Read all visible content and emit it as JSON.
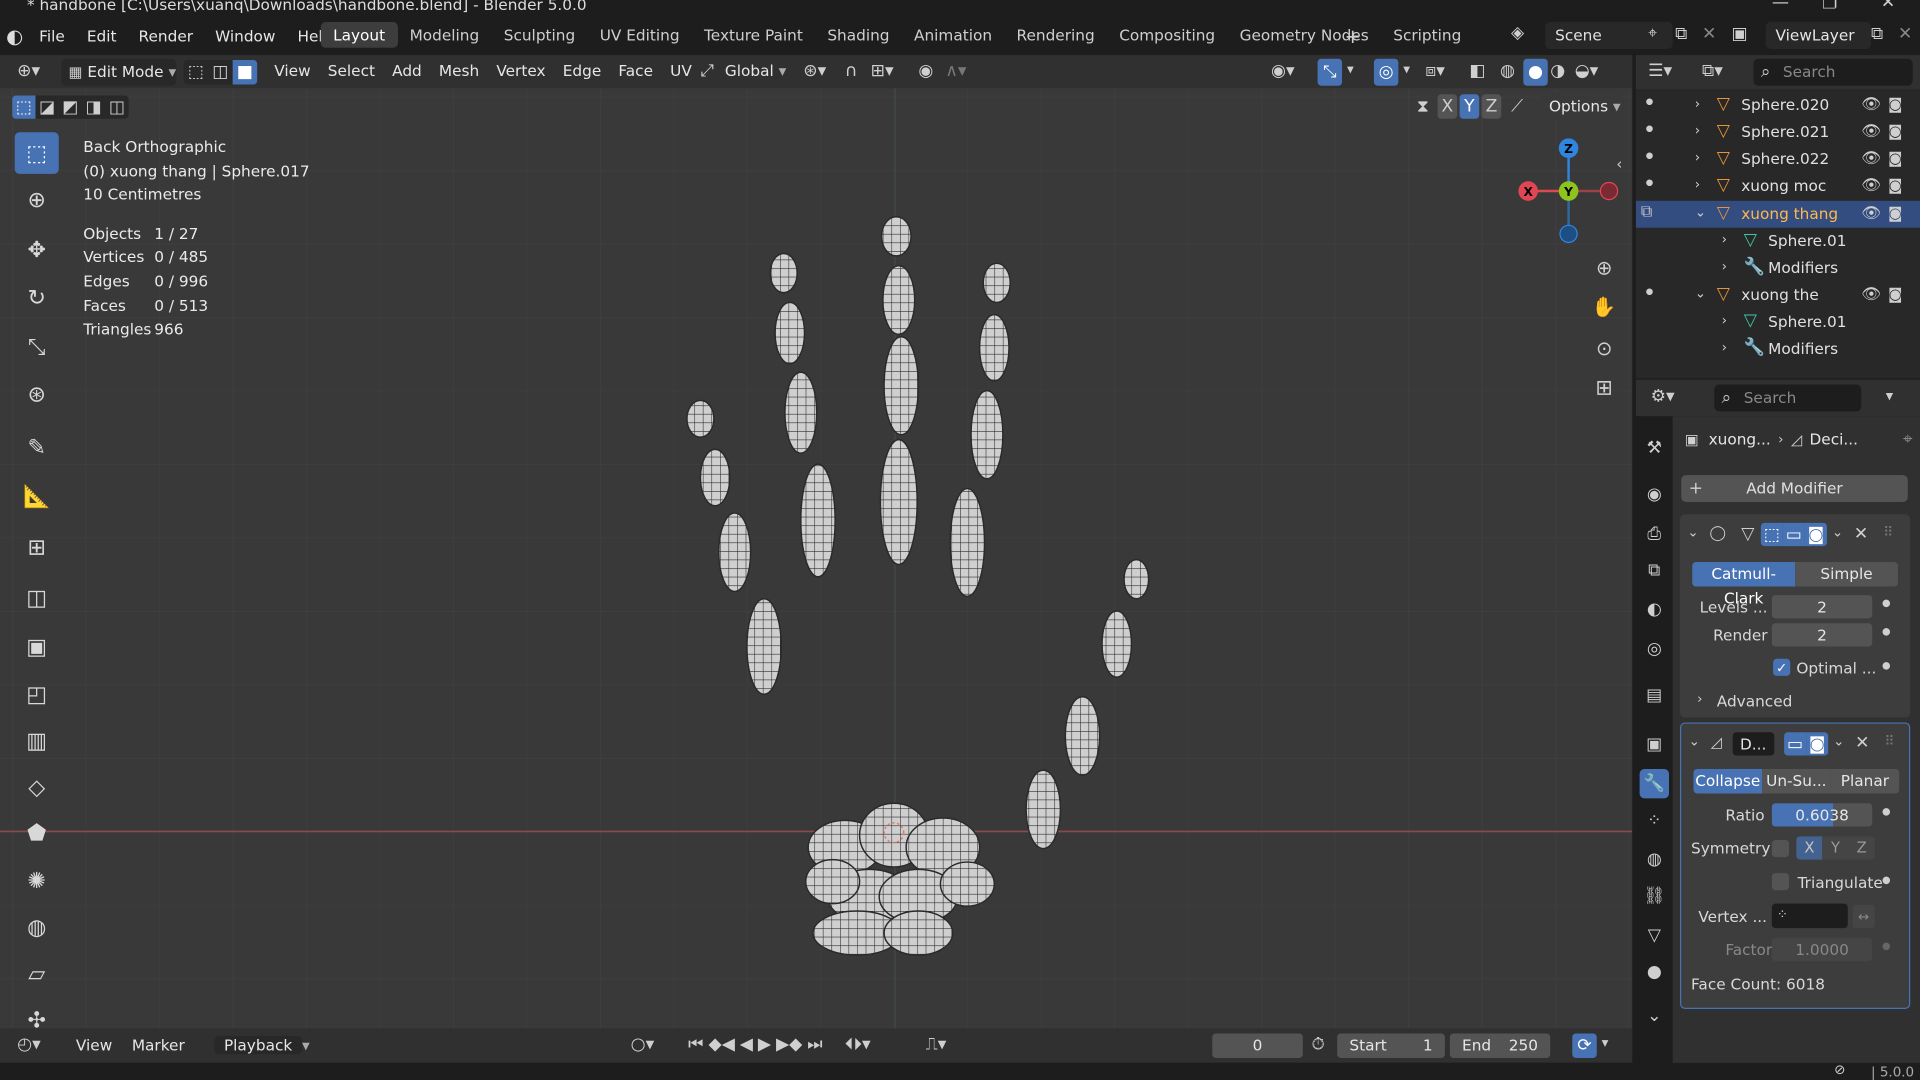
{
  "window": {
    "title": "* handbone [C:\\Users\\xuanq\\Downloads\\handbone.blend] - Blender 5.0.0"
  },
  "menu": [
    "File",
    "Edit",
    "Render",
    "Window",
    "Help"
  ],
  "workspaces": [
    "Layout",
    "Modeling",
    "Sculpting",
    "UV Editing",
    "Texture Paint",
    "Shading",
    "Animation",
    "Rendering",
    "Compositing",
    "Geometry Nodes",
    "Scripting"
  ],
  "scene": {
    "label": "Scene",
    "view_layer": "ViewLayer"
  },
  "header": {
    "mode": "Edit Mode",
    "menus": [
      "View",
      "Select",
      "Add",
      "Mesh",
      "Vertex",
      "Edge",
      "Face",
      "UV"
    ],
    "orientation": "Global",
    "axes": [
      "X",
      "Y",
      "Z"
    ],
    "options": "Options"
  },
  "overlay": {
    "view": "Back Orthographic",
    "object": "(0) xuong thang | Sphere.017",
    "scale": "10 Centimetres",
    "stats": [
      {
        "k": "Objects",
        "v": "1 / 27"
      },
      {
        "k": "Vertices",
        "v": "0 / 485"
      },
      {
        "k": "Edges",
        "v": "0 / 996"
      },
      {
        "k": "Faces",
        "v": "0 / 513"
      },
      {
        "k": "Triangles",
        "v": "966"
      }
    ]
  },
  "gizmo": {
    "x": "X",
    "y": "Y",
    "z": "Z"
  },
  "outliner": {
    "search": "Search",
    "rows": [
      {
        "name": "Sphere.020",
        "kind": "object"
      },
      {
        "name": "Sphere.021",
        "kind": "object"
      },
      {
        "name": "Sphere.022",
        "kind": "object"
      },
      {
        "name": "xuong moc",
        "kind": "object"
      },
      {
        "name": "xuong thang",
        "kind": "object",
        "selected": true
      },
      {
        "name": "Sphere.01",
        "kind": "mesh"
      },
      {
        "name": "Modifiers",
        "kind": "modifier"
      },
      {
        "name": "xuong the",
        "kind": "object"
      },
      {
        "name": "Sphere.01",
        "kind": "mesh"
      },
      {
        "name": "Modifiers",
        "kind": "modifier"
      }
    ]
  },
  "properties": {
    "search": "Search",
    "breadcrumb_object": "xuong...",
    "breadcrumb_modifier": "Deci...",
    "add_modifier": "Add Modifier",
    "subsurf": {
      "types": [
        "Catmull-Clark",
        "Simple"
      ],
      "levels_label": "Levels ...",
      "levels": "2",
      "render_label": "Render",
      "render": "2",
      "optimal": "Optimal ...",
      "advanced": "Advanced"
    },
    "decimate": {
      "name": "D...",
      "modes": [
        "Collapse",
        "Un-Su...",
        "Planar"
      ],
      "ratio_label": "Ratio",
      "ratio": "0.6038",
      "symmetry": "Symmetry",
      "sym_axes": [
        "X",
        "Y",
        "Z"
      ],
      "triangulate": "Triangulate",
      "vertex_label": "Vertex ...",
      "factor_label": "Factor",
      "factor": "1.0000",
      "face_count": "Face Count: 6018"
    }
  },
  "timeline": {
    "menus": [
      "View",
      "Marker",
      "Playback"
    ],
    "frame": "0",
    "start_label": "Start",
    "start": "1",
    "end_label": "End",
    "end": "250"
  },
  "status": {
    "version": "5.0.0"
  },
  "colors": {
    "accent": "#4772b3",
    "viewport": "#393939",
    "panel": "#303030",
    "x_axis": "#e04653",
    "y_axis": "#8dc21f",
    "z_axis": "#2f86e0"
  }
}
